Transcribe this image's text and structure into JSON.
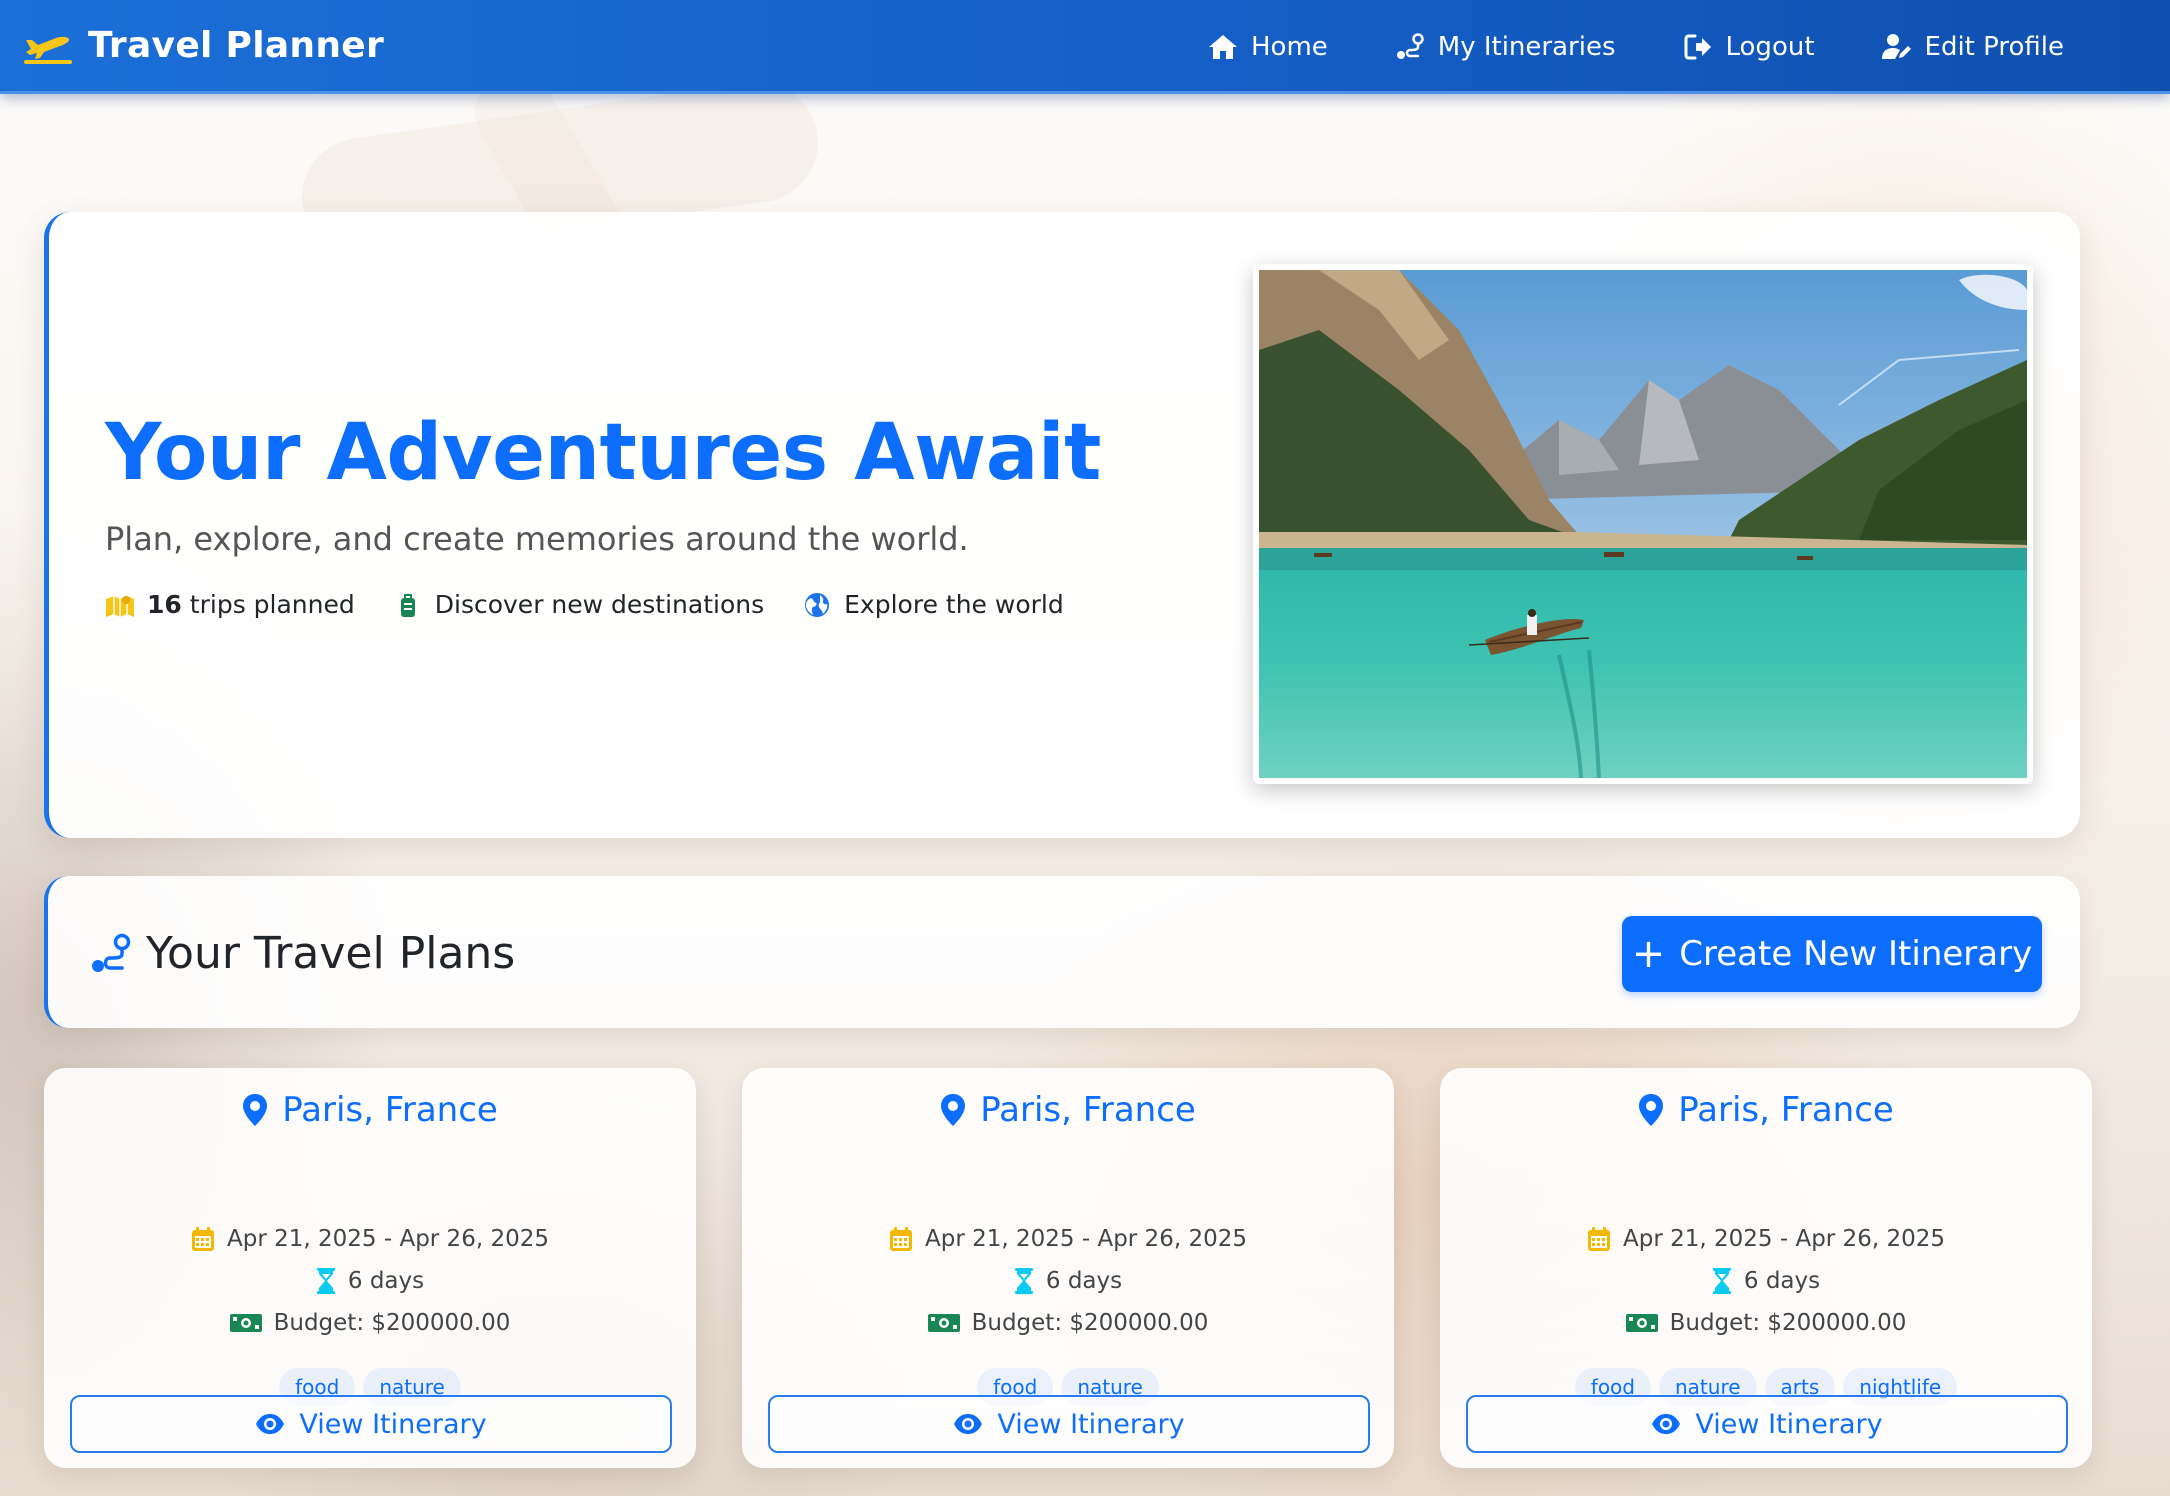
{
  "app": {
    "title": "Travel Planner"
  },
  "nav": {
    "items": [
      {
        "label": "Home",
        "icon": "home-icon"
      },
      {
        "label": "My Itineraries",
        "icon": "route-icon"
      },
      {
        "label": "Logout",
        "icon": "logout-icon"
      },
      {
        "label": "Edit Profile",
        "icon": "user-edit-icon"
      }
    ]
  },
  "hero": {
    "title": "Your Adventures Await",
    "subtitle": "Plan, explore, and create memories around the world.",
    "stats": {
      "trips_count": "16",
      "trips_label": "trips planned",
      "discover": "Discover new destinations",
      "explore": "Explore the world"
    },
    "image": "mountain-lake-boat-photo"
  },
  "plans": {
    "title": "Your Travel Plans",
    "create_label": "Create New Itinerary",
    "cards": [
      {
        "location": "Paris, France",
        "dates": "Apr 21, 2025 - Apr 26, 2025",
        "duration": "6 days",
        "budget": "Budget: $200000.00",
        "tags": [
          "food",
          "nature"
        ],
        "view_label": "View Itinerary"
      },
      {
        "location": "Paris, France",
        "dates": "Apr 21, 2025 - Apr 26, 2025",
        "duration": "6 days",
        "budget": "Budget: $200000.00",
        "tags": [
          "food",
          "nature"
        ],
        "view_label": "View Itinerary"
      },
      {
        "location": "Paris, France",
        "dates": "Apr 21, 2025 - Apr 26, 2025",
        "duration": "6 days",
        "budget": "Budget: $200000.00",
        "tags": [
          "food",
          "nature",
          "arts",
          "nightlife"
        ],
        "view_label": "View Itinerary"
      }
    ]
  },
  "colors": {
    "primary": "#0d6efd",
    "navbar": "#1b6fd6",
    "accent_yellow": "#f5c518",
    "budget_green": "#198754",
    "hourglass_cyan": "#0dcaf0"
  }
}
